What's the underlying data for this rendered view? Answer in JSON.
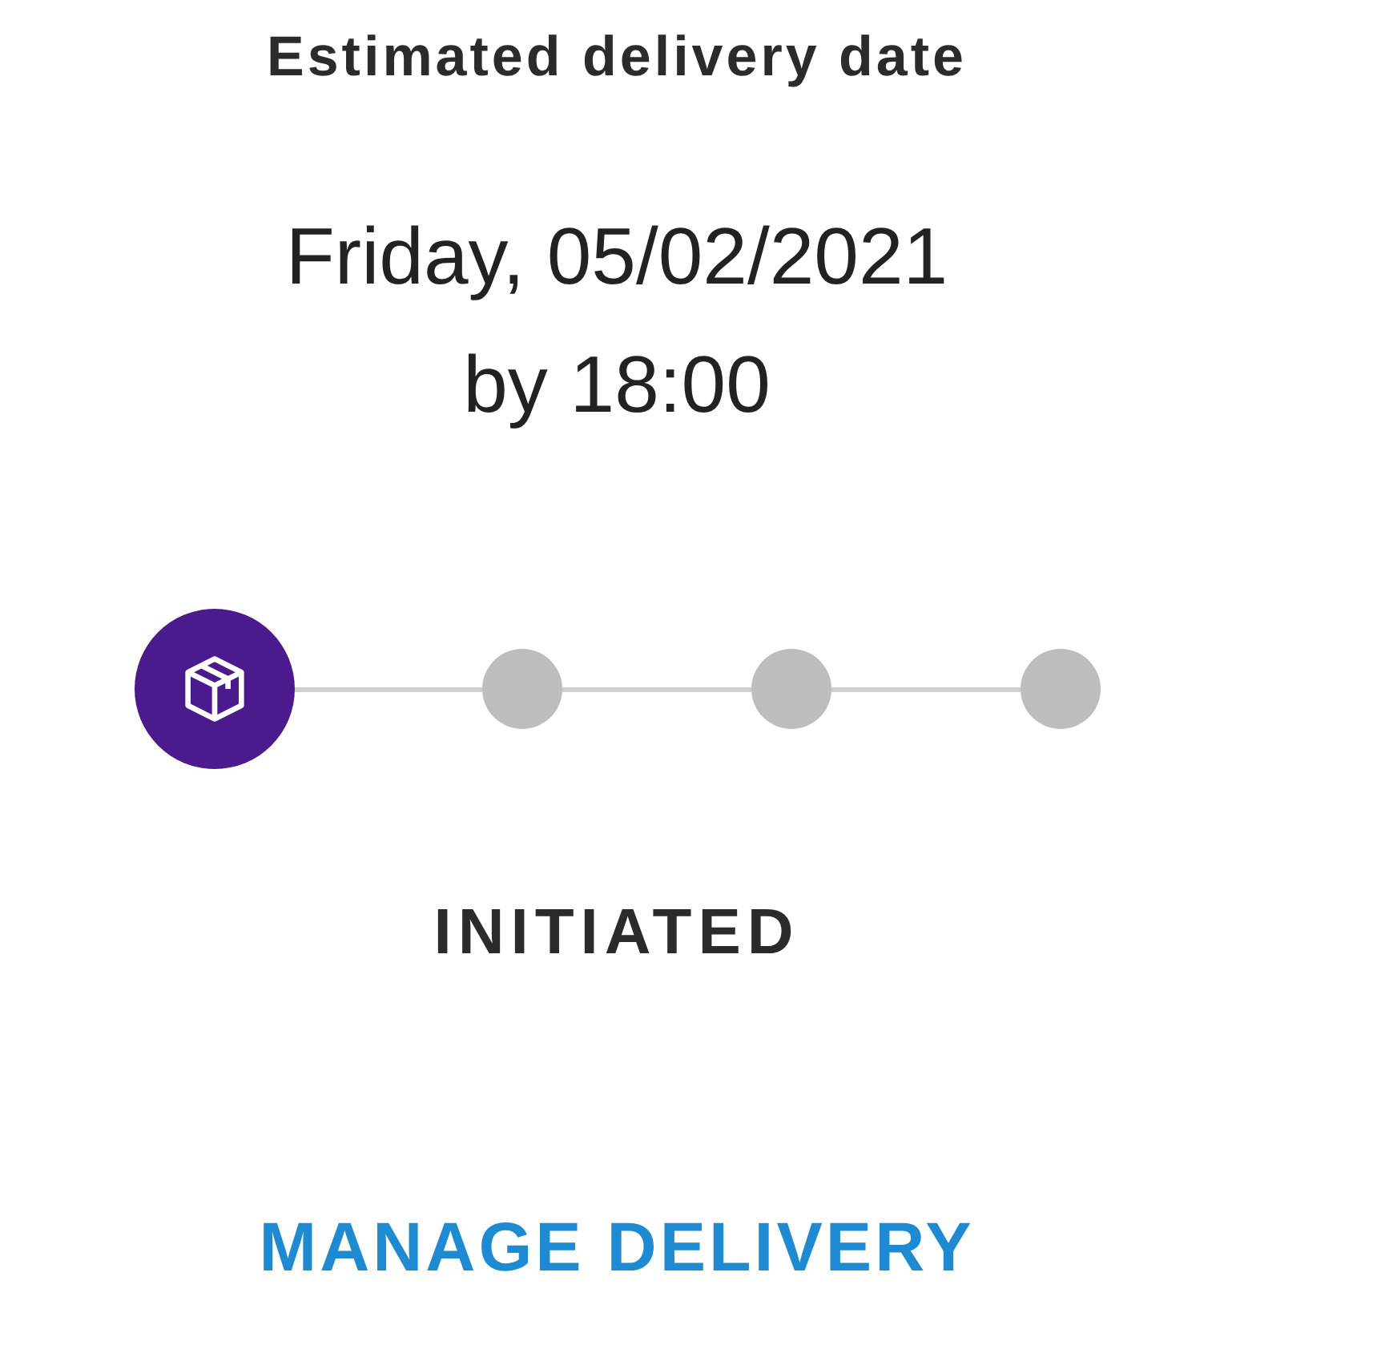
{
  "title": "Estimated delivery date",
  "date_lines": [
    "Friday, 05/02/2021",
    "by 18:00"
  ],
  "steps": [
    {
      "active": true
    },
    {
      "active": false
    },
    {
      "active": false
    },
    {
      "active": false
    }
  ],
  "status": "INITIATED",
  "action": "MANAGE DELIVERY"
}
